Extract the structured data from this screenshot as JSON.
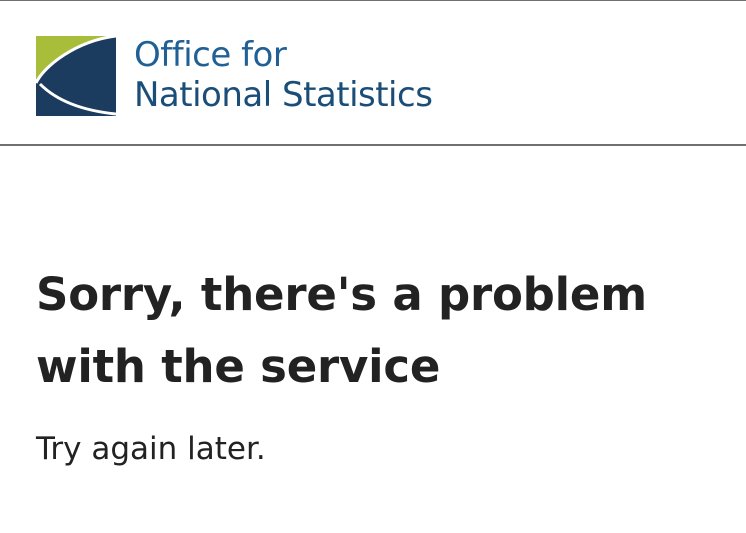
{
  "header": {
    "logo": {
      "line1": "Office for",
      "line2": "National Statistics",
      "icon": "ons-logo-icon",
      "colors": {
        "green": "#a8bd3a",
        "navy": "#1b3c5e",
        "text": "#206095"
      }
    }
  },
  "main": {
    "heading": "Sorry, there's a problem with the service",
    "message": "Try again later."
  }
}
